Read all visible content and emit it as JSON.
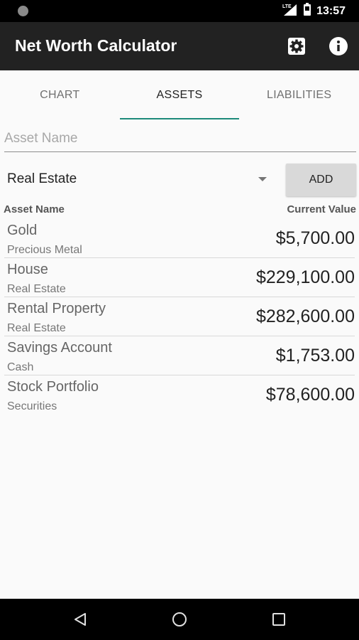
{
  "status_bar": {
    "time": "13:57",
    "network": "LTE"
  },
  "app_bar": {
    "title": "Net Worth Calculator",
    "icons": [
      "settings-icon",
      "info-icon"
    ]
  },
  "tabs": [
    {
      "label": "CHART",
      "active": false
    },
    {
      "label": "ASSETS",
      "active": true
    },
    {
      "label": "LIABILITIES",
      "active": false
    }
  ],
  "form": {
    "name_placeholder": "Asset Name",
    "name_value": "",
    "category_selected": "Real Estate",
    "add_label": "ADD"
  },
  "list": {
    "header_name": "Asset Name",
    "header_value": "Current Value",
    "items": [
      {
        "name": "Gold",
        "category": "Precious Metal",
        "value": "$5,700.00"
      },
      {
        "name": "House",
        "category": "Real Estate",
        "value": "$229,100.00"
      },
      {
        "name": "Rental Property",
        "category": "Real Estate",
        "value": "$282,600.00"
      },
      {
        "name": "Savings Account",
        "category": "Cash",
        "value": "$1,753.00"
      },
      {
        "name": "Stock Portfolio",
        "category": "Securities",
        "value": "$78,600.00"
      }
    ]
  },
  "colors": {
    "accent": "#1e8a7a",
    "app_bar": "#222222",
    "background": "#fafafa"
  },
  "nav_bar": {
    "icons": [
      "back-icon",
      "home-icon",
      "recents-icon"
    ]
  }
}
